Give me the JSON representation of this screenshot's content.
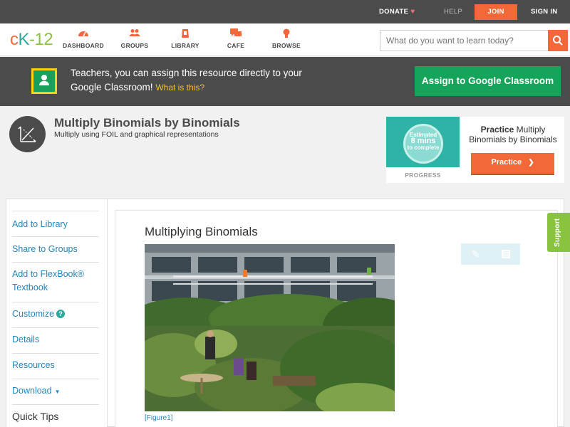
{
  "topbar": {
    "donate": "DONATE",
    "help": "HELP",
    "join": "JOIN",
    "signin": "SIGN IN"
  },
  "nav": {
    "logo": {
      "c": "c",
      "k": "K",
      "n": "-12"
    },
    "items": [
      {
        "label": "DASHBOARD",
        "icon": "dashboard-icon"
      },
      {
        "label": "GROUPS",
        "icon": "groups-icon"
      },
      {
        "label": "LIBRARY",
        "icon": "library-icon"
      },
      {
        "label": "CAFE",
        "icon": "cafe-icon"
      },
      {
        "label": "BROWSE",
        "icon": "browse-icon"
      }
    ],
    "search_placeholder": "What do you want to learn today?"
  },
  "banner": {
    "text": "Teachers, you can assign this resource directly to your Google Classroom!",
    "link": "What is this?",
    "assign_button": "Assign to Google Classroom"
  },
  "concept": {
    "title": "Multiply Binomials by Binomials",
    "subtitle": "Multiply using FOIL and graphical representations"
  },
  "practice": {
    "estimated_line1": "Estimated",
    "estimated_line2": "8 mins",
    "estimated_line3": "to complete",
    "progress_label": "PROGRESS",
    "heading_bold": "Practice",
    "heading_rest": " Multiply Binomials by Binomials",
    "button": "Practice"
  },
  "sidebar": {
    "items": [
      {
        "label": "Add to Library"
      },
      {
        "label": "Share to Groups"
      },
      {
        "label": "Add to FlexBook® Textbook"
      },
      {
        "label": "Customize"
      },
      {
        "label": "Details"
      },
      {
        "label": "Resources"
      },
      {
        "label": "Download"
      }
    ],
    "quick_tips": "Quick Tips"
  },
  "article": {
    "title": "Multiplying Binomials",
    "caption": "[Figure1]"
  },
  "support": "Support",
  "colors": {
    "accent_orange": "#f26839",
    "teal": "#2eaa9f",
    "green": "#8ac43f",
    "classroom_green": "#16a35a",
    "dark_bar": "#4b4b4b",
    "link_blue": "#2785b9"
  }
}
